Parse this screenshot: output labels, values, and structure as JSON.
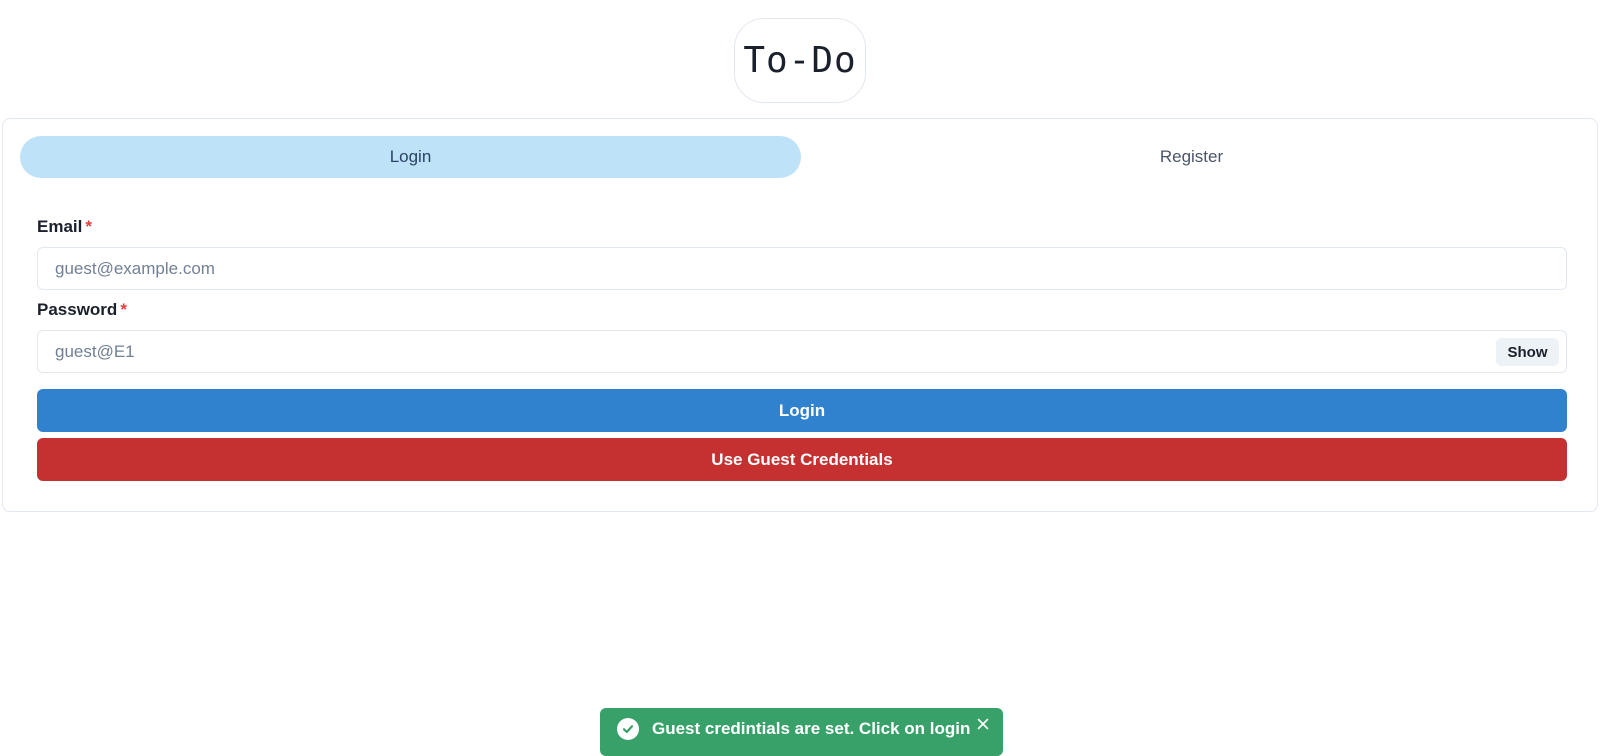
{
  "app": {
    "logo_text": "To-Do"
  },
  "tabs": [
    {
      "label": "Login",
      "active": true
    },
    {
      "label": "Register",
      "active": false
    }
  ],
  "form": {
    "email": {
      "label": "Email",
      "required_marker": "*",
      "value": "",
      "placeholder": "guest@example.com"
    },
    "password": {
      "label": "Password",
      "required_marker": "*",
      "value": "",
      "placeholder": "guest@E1",
      "toggle_label": "Show"
    },
    "login_button": "Login",
    "guest_button": "Use Guest Credentials"
  },
  "toast": {
    "message": "Guest credintials are set. Click on login",
    "status": "success",
    "icon": "check-circle-icon",
    "close_icon": "close-icon"
  },
  "colors": {
    "tab_active_bg": "#bee3f8",
    "primary": "#3182ce",
    "danger": "#c53030",
    "success": "#38a169",
    "required": "#e53e3e"
  }
}
